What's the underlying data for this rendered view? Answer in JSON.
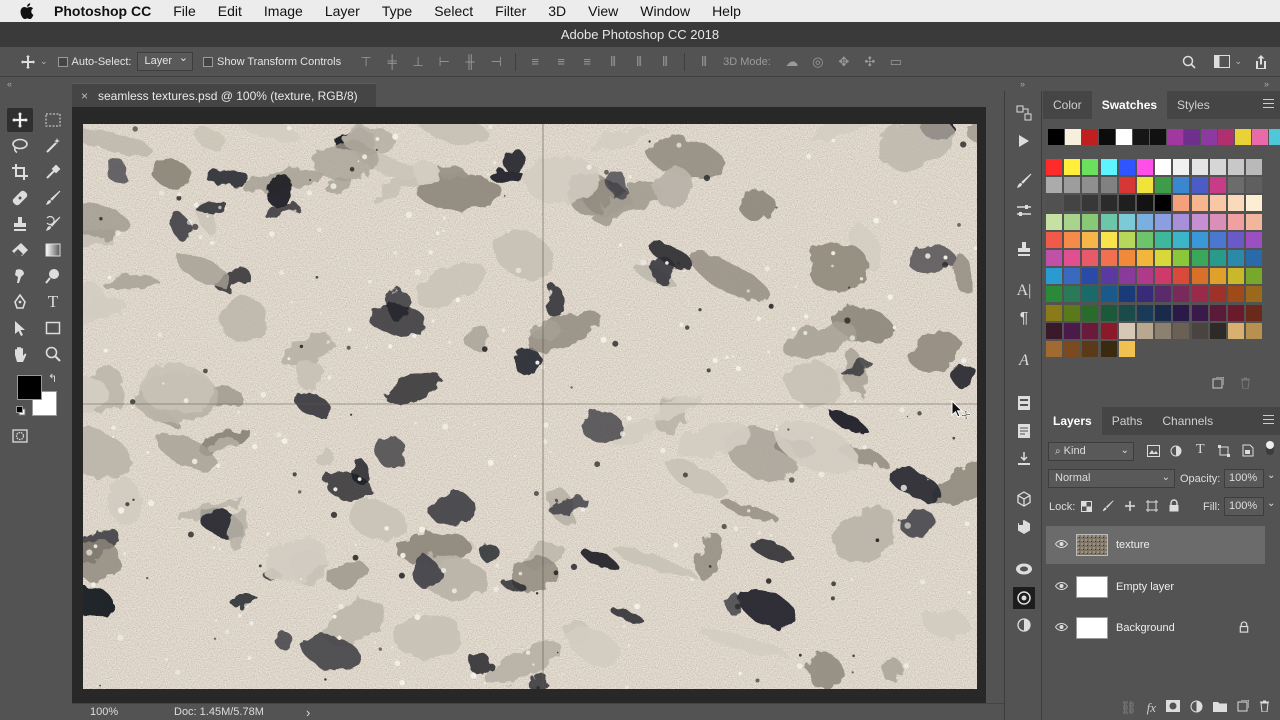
{
  "menubar": {
    "app_name": "Photoshop CC",
    "items": [
      "File",
      "Edit",
      "Image",
      "Layer",
      "Type",
      "Select",
      "Filter",
      "3D",
      "View",
      "Window",
      "Help"
    ]
  },
  "window": {
    "title": "Adobe Photoshop CC 2018"
  },
  "options_bar": {
    "auto_select_label": "Auto-Select:",
    "auto_select_value": "Layer",
    "show_transform_label": "Show Transform Controls",
    "mode_3d_label": "3D Mode:"
  },
  "document": {
    "tab_title": "seamless textures.psd @ 100% (texture, RGB/8)",
    "close_glyph": "×"
  },
  "status_bar": {
    "zoom": "100%",
    "doc_info": "Doc: 1.45M/5.78M",
    "arrow": "›"
  },
  "swatch_panel": {
    "tabs": [
      "Color",
      "Swatches",
      "Styles"
    ],
    "active_tab": "Swatches"
  },
  "layers_panel": {
    "tabs": [
      "Layers",
      "Paths",
      "Channels"
    ],
    "active_tab": "Layers",
    "filter_kind": "Kind",
    "blend_mode": "Normal",
    "opacity_label": "Opacity:",
    "opacity_value": "100%",
    "lock_label": "Lock:",
    "fill_label": "Fill:",
    "fill_value": "100%",
    "layers": [
      {
        "name": "texture",
        "selected": true
      },
      {
        "name": "Empty layer",
        "selected": false
      },
      {
        "name": "Background",
        "selected": false,
        "locked": true
      }
    ]
  },
  "colors": {
    "ui_bg": "#535353",
    "panel_dark": "#454545",
    "canvas_bg": "#282828",
    "foreground": "#000000",
    "background": "#ffffff"
  },
  "swatches_row1": [
    "#000000",
    "#f5efdc",
    "#c01f1f",
    "#0c0c0c",
    "#ffffff",
    "#161616",
    "#111111",
    "#a038a0",
    "#6f2f8c",
    "#8a3aa0",
    "#b02f6e",
    "#e9d238",
    "#e86aa8",
    "#4ec7d8"
  ],
  "swatch_grid": [
    [
      "#ff2b2b",
      "#ffef3a",
      "#6be05c",
      "#5ef4ff",
      "#2e55ff",
      "#ff4fe9",
      "#ffffff",
      "#f1f1f1",
      "#e4e4e4",
      "#d6d6d6",
      "#c8c8c8",
      "#b9b9b9"
    ],
    [
      "#ababab",
      "#9d9d9d",
      "#8f8f8f",
      "#818181",
      "#d73636",
      "#f0e43a",
      "#3e9b4a",
      "#3a86d0",
      "#4b5cc8",
      "#c83b86",
      "#6c6c6c",
      "#5f5f5f"
    ],
    [
      "#515151",
      "#444444",
      "#383838",
      "#2b2b2b",
      "#1f1f1f",
      "#131313",
      "#000000",
      "#f4a07a",
      "#f6b58f",
      "#f8c8a5",
      "#f9dbbc",
      "#fbeed2"
    ],
    [
      "#c7e0a4",
      "#a8d48d",
      "#88c975",
      "#6cc7a8",
      "#7cc9d8",
      "#7ab0e0",
      "#8c9ee2",
      "#a690d9",
      "#c590d2",
      "#d98fb8",
      "#f0a0a0",
      "#f2b69c"
    ],
    [
      "#f05a4a",
      "#f68a4a",
      "#f8b64a",
      "#fae24a",
      "#b6d85a",
      "#6cc56a",
      "#3eb89a",
      "#3ab6c8",
      "#3a98d8",
      "#4a78d0",
      "#6a5ac8",
      "#9a50c0"
    ],
    [
      "#c050a8",
      "#e05090",
      "#e85a6a",
      "#f07050",
      "#f08a3a",
      "#f2b63a",
      "#d8d83a",
      "#8ac83a",
      "#3aa85a",
      "#2a9a8a",
      "#2a8aa8",
      "#2a6aa8"
    ],
    [
      "#2a9ad0",
      "#3a6ac0",
      "#2a4aa8",
      "#5a3aa0",
      "#8a3a9a",
      "#b03a8a",
      "#d03a6a",
      "#d84a3a",
      "#d8702a",
      "#e0a02a",
      "#c8b82a",
      "#78a82a"
    ],
    [
      "#2a8a3a",
      "#2a7a5a",
      "#1a6a6a",
      "#1a5a8a",
      "#1a3a7a",
      "#3a2a7a",
      "#5a2a6a",
      "#7a2a5a",
      "#9a2a4a",
      "#a0302a",
      "#a04a1a",
      "#9a6a1a"
    ],
    [
      "#8a7a1a",
      "#5a7a1a",
      "#2a6a2a",
      "#1a5a3a",
      "#1a4a4a",
      "#1a3a5a",
      "#1a2a4a",
      "#2a1a4a",
      "#3a1a4a",
      "#5a1a3a",
      "#6a1a2a",
      "#6a2a1a"
    ],
    [
      "#3a1a2a",
      "#4a1a4a",
      "#6a1a3a",
      "#8a1a2a",
      "#d6c8b4",
      "#b8a890",
      "#8c8070",
      "#6a6054",
      "#4a4440",
      "#2e2a28",
      "#d8b070",
      "#b89050"
    ],
    [
      "#a06a30",
      "#7a4a20",
      "#5a3a18",
      "#3a2a10",
      "#f0c050"
    ]
  ]
}
